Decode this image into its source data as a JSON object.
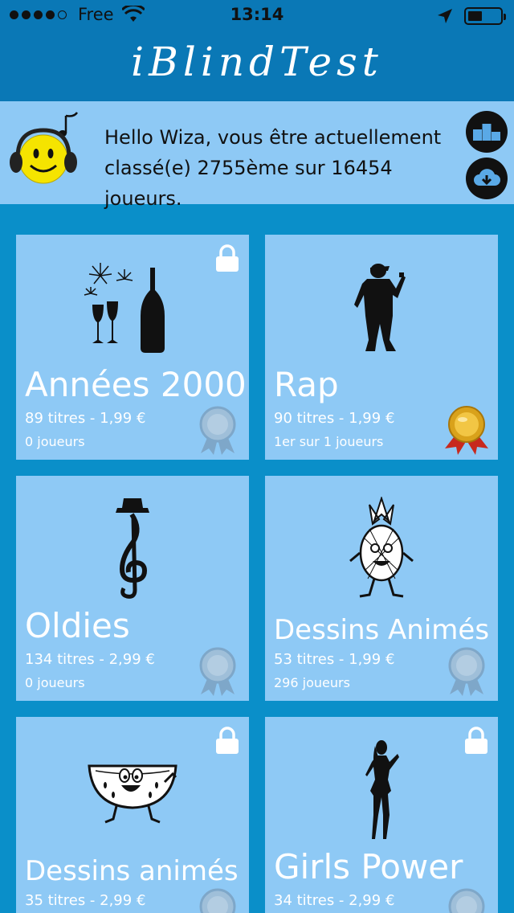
{
  "status_bar": {
    "carrier": "Free",
    "time": "13:14",
    "icons": [
      "signal-dots",
      "wifi-icon",
      "location-arrow-icon",
      "battery-icon"
    ]
  },
  "app": {
    "title": "iBlindTest"
  },
  "user": {
    "line1": "Hello Wiza, vous être actuellement",
    "line2": "classé(e) 2755ème sur 16454 joueurs."
  },
  "cards": [
    {
      "name": "Années 2000",
      "meta": "89 titres - 1,99 €",
      "players": "0 joueurs",
      "locked": true,
      "medal": "silver",
      "icon": "champagne-icon"
    },
    {
      "name": "Rap",
      "meta": "90 titres - 1,99 €",
      "players": "1er sur 1 joueurs",
      "locked": false,
      "medal": "gold",
      "icon": "rapper-icon"
    },
    {
      "name": "Oldies",
      "meta": "134 titres - 2,99 €",
      "players": "0 joueurs",
      "locked": false,
      "medal": "silver",
      "icon": "treble-clef-hat-icon"
    },
    {
      "name": "Dessins Animés",
      "meta": "53 titres - 1,99 €",
      "players": "296 joueurs",
      "locked": false,
      "medal": "silver",
      "icon": "pineapple-icon"
    },
    {
      "name": "Dessins animés II",
      "meta": "35 titres - 2,99 €",
      "players": "",
      "locked": true,
      "medal": "silver",
      "icon": "watermelon-icon"
    },
    {
      "name": "Girls Power",
      "meta": "34 titres - 2,99 €",
      "players": "",
      "locked": true,
      "medal": "silver",
      "icon": "woman-silhouette-icon"
    }
  ],
  "colors": {
    "background": "#0a8fc9",
    "header": "#0a78b6",
    "card": "#8ec9f5",
    "text": "#ffffff"
  }
}
